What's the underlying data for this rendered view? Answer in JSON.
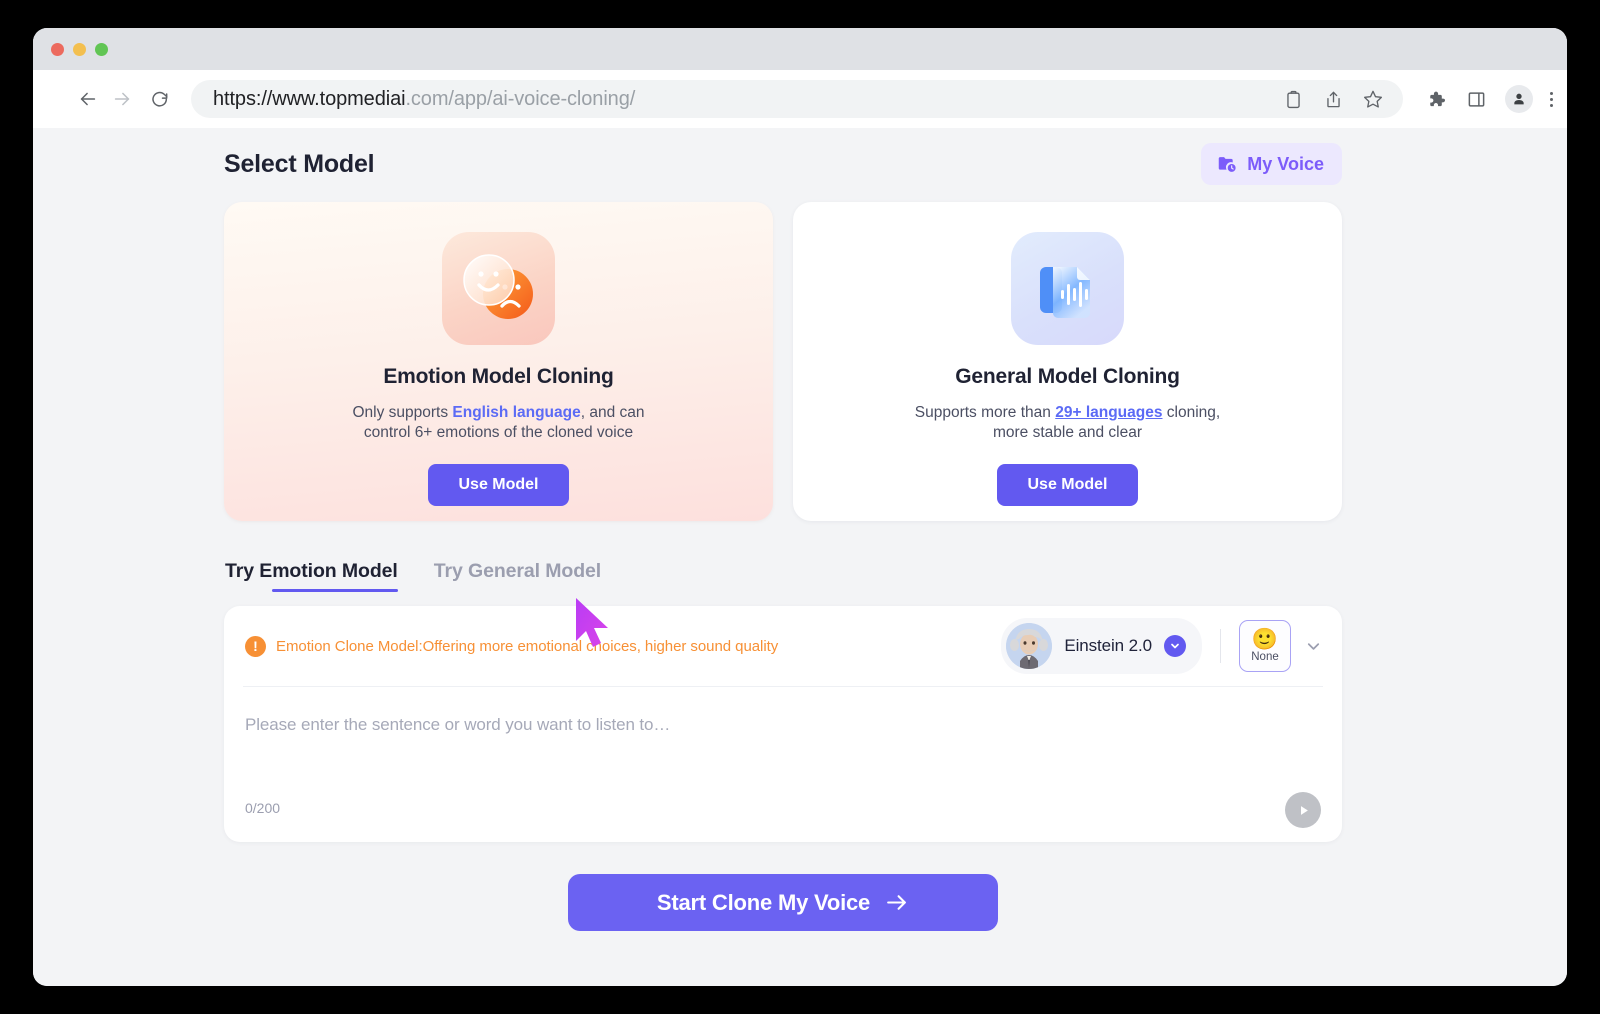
{
  "browser": {
    "url_strong": "https://www.topmediai",
    "url_rest": ".com/app/ai-voice-cloning/",
    "back_icon": "back-arrow-icon",
    "forward_icon": "forward-arrow-icon",
    "reload_icon": "reload-icon",
    "toolbar_icons": [
      "clipboard-icon",
      "share-icon",
      "bookmark-star-icon",
      "extensions-puzzle-icon",
      "side-panel-icon",
      "profile-icon",
      "browser-menu-icon"
    ]
  },
  "header": {
    "title": "Select Model",
    "my_voice_label": "My Voice",
    "my_voice_icon": "folder-clock-icon",
    "accent_purple": "#7c5cfa"
  },
  "cards": [
    {
      "id": "emotion",
      "icon": "emotion-faces-icon",
      "title": "Emotion Model Cloning",
      "desc_before": "Only supports ",
      "desc_link": "English language",
      "desc_after": ", and can control 6+ emotions of the cloned voice",
      "button_label": "Use Model",
      "accent": "#6259f0"
    },
    {
      "id": "general",
      "icon": "document-waveform-icon",
      "title": "General Model Cloning",
      "desc_before": "Supports more than ",
      "desc_link": "29+ languages",
      "desc_after": " cloning, more stable and clear",
      "button_label": "Use Model",
      "accent": "#6259f0"
    }
  ],
  "tabs": [
    {
      "label_prefix": "Try",
      "label": "Try Emotion Model",
      "active": true
    },
    {
      "label_prefix": "",
      "label": "Try General Model",
      "active": false
    }
  ],
  "editor": {
    "notice_icon": "exclamation-circle-icon",
    "notice_text": "Emotion Clone Model:Offering more emotional choices, higher sound quality",
    "notice_color": "#f79035",
    "voice_name": "Einstein 2.0",
    "voice_avatar": "einstein-avatar",
    "voice_chevron_icon": "chevron-down-icon",
    "emotion_emoji": "🙂",
    "emotion_label": "None",
    "emotion_chevron_icon": "chevron-down-icon",
    "placeholder": "Please enter the sentence or word you want to listen to…",
    "char_count": "0/200",
    "play_icon": "play-icon"
  },
  "cta": {
    "label": "Start Clone My Voice",
    "arrow_icon": "arrow-right-icon",
    "color": "#6b62f2"
  },
  "cursor": {
    "icon": "mouse-pointer-icon",
    "color": "#c23cf0"
  }
}
